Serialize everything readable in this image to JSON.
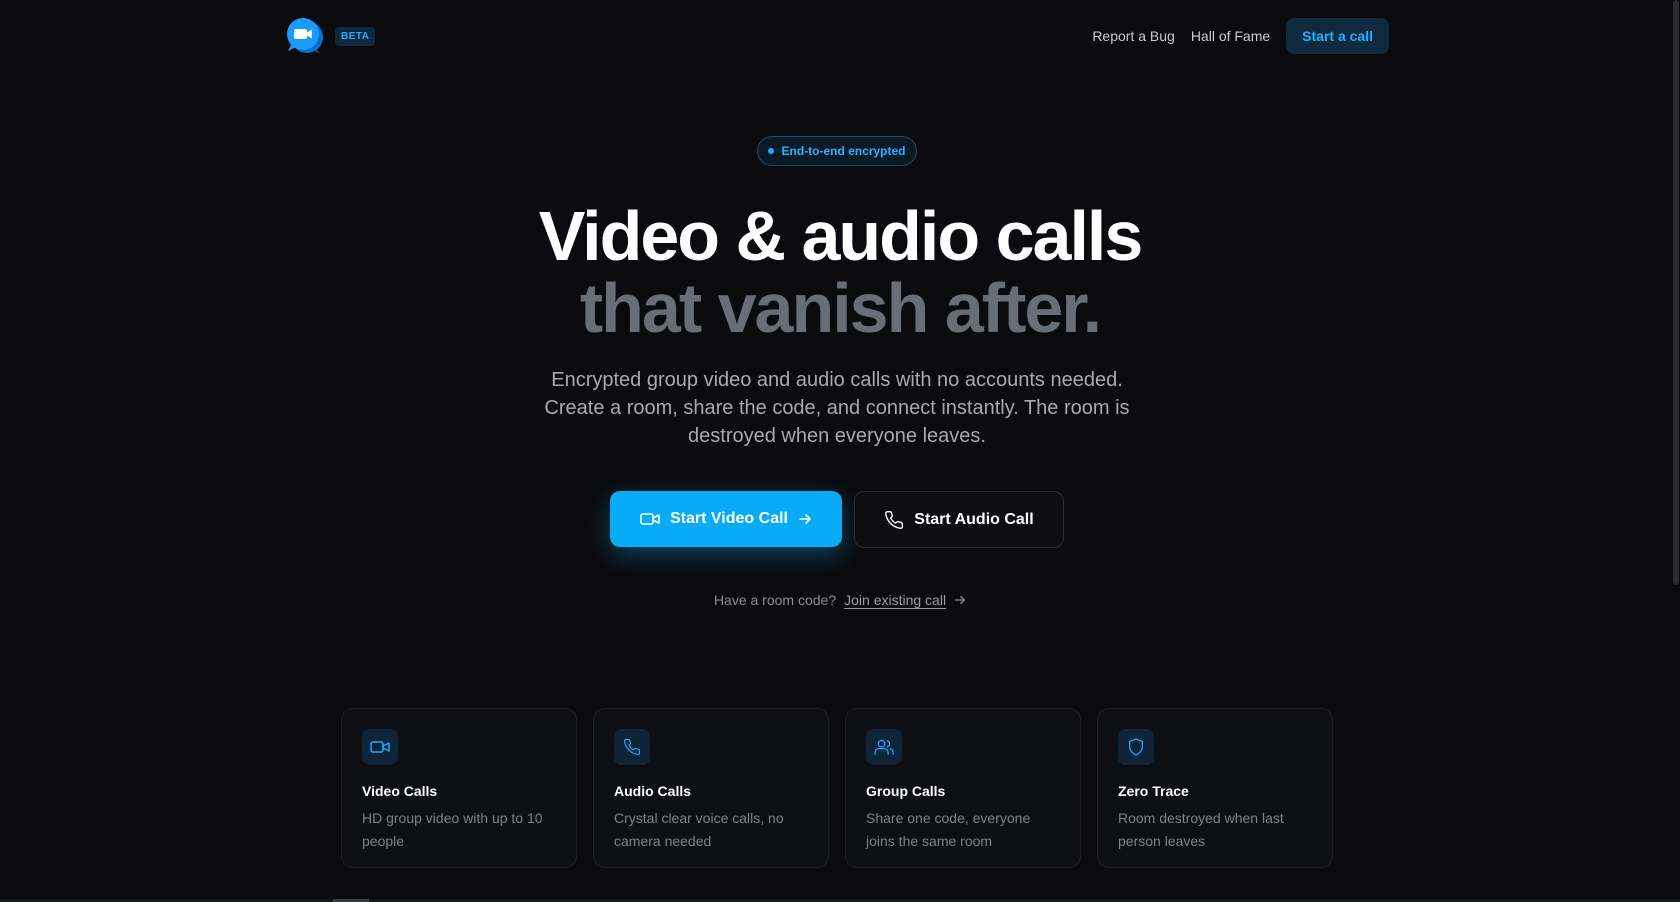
{
  "header": {
    "badge": "BETA",
    "nav": {
      "report_bug": "Report a Bug",
      "hall_of_fame": "Hall of Fame",
      "start_call": "Start a call"
    }
  },
  "hero": {
    "badge": "End-to-end encrypted",
    "headline_line1": "Video & audio calls",
    "headline_line2": "that vanish after.",
    "subtitle": "Encrypted group video and audio calls with no accounts needed. Create a room, share the code, and connect instantly. The room is destroyed when everyone leaves.",
    "primary_cta": "Start Video Call",
    "secondary_cta": "Start Audio Call",
    "join_prompt": "Have a room code?",
    "join_link": "Join existing call"
  },
  "features": [
    {
      "icon": "video-icon",
      "title": "Video Calls",
      "desc": "HD group video with up to 10 people"
    },
    {
      "icon": "phone-icon",
      "title": "Audio Calls",
      "desc": "Crystal clear voice calls, no camera needed"
    },
    {
      "icon": "users-icon",
      "title": "Group Calls",
      "desc": "Share one code, everyone joins the same room"
    },
    {
      "icon": "shield-icon",
      "title": "Zero Trace",
      "desc": "Room destroyed when last person leaves"
    }
  ],
  "colors": {
    "background": "#0b0b0f",
    "accent": "#09aaf6",
    "muted_headline": "#686d78"
  }
}
